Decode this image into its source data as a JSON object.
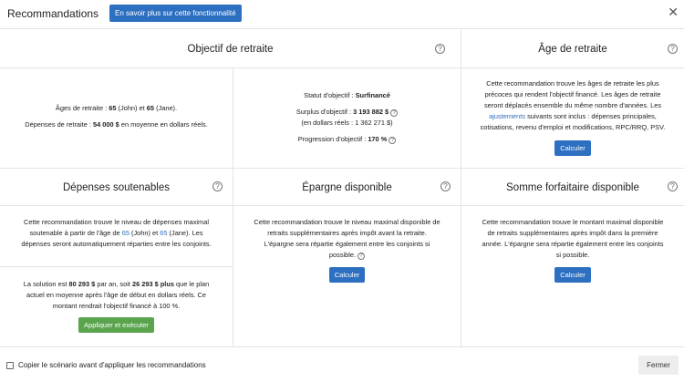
{
  "header": {
    "title": "Recommandations",
    "info_button": "En savoir plus sur cette fonctionnalité",
    "close_symbol": "✕"
  },
  "objectif": {
    "title": "Objectif de retraite",
    "ages_label": "Âges de retraite : ",
    "ages_john": "65",
    "ages_john_name": " (John) et ",
    "ages_jane": "65",
    "ages_jane_name": " (Jane).",
    "depenses_label": "Dépenses de retraite : ",
    "depenses_value": "54 000 $",
    "depenses_suffix": " en moyenne en dollars réels.",
    "statut_label": "Statut d'objectif : ",
    "statut_value": "Surfinancé",
    "surplus_label": "Surplus d'objectif : ",
    "surplus_value": "3 193 882 $",
    "surplus_real": "(en dollars réels : 1 362 271 $)",
    "progression_label": "Progression d'objectif : ",
    "progression_value": "170 %"
  },
  "age_retraite": {
    "title": "Âge de retraite",
    "text_1": "Cette recommandation trouve les âges de retraite les plus",
    "text_2": "précoces qui rendent l'objectif financé. Les âges de retraite",
    "text_3": "seront déplacés ensemble du même nombre d'années. Les",
    "text_link": "ajustements",
    "text_4": " suivants sont inclus : dépenses principales,",
    "text_5": "cotisations, revenu d'emploi et modifications, RPC/RRQ, PSV.",
    "button": "Calculer"
  },
  "depenses": {
    "title": "Dépenses soutenables",
    "text_1": "Cette recommandation trouve le niveau de dépenses maximal",
    "text_2a": "soutenable à partir de l'âge de ",
    "text_2_age1": "65",
    "text_2b": " (John) et ",
    "text_2_age2": "65",
    "text_2c": " (Jane). Les",
    "text_3": "dépenses seront automatiquement réparties entre les conjoints.",
    "sol_1a": "La solution est ",
    "sol_1_value": "80 293 $",
    "sol_1b": " par an, soit ",
    "sol_1_plus": "26 293 $ plus",
    "sol_1c": " que le plan",
    "sol_2": "actuel en moyenne après l'âge de début en dollars réels. Ce",
    "sol_3": "montant rendrait l'objectif financé à 100 %.",
    "button": "Appliquer et exécuter"
  },
  "epargne": {
    "title": "Épargne disponible",
    "text_1": "Cette recommandation trouve le niveau maximal disponible de",
    "text_2": "retraits supplémentaires après impôt avant la retraite.",
    "text_3": "L'épargne sera répartie également entre les conjoints si",
    "text_4": "possible.",
    "button": "Calculer"
  },
  "forfaitaire": {
    "title": "Somme forfaitaire disponible",
    "text_1": "Cette recommandation trouve le montant maximal disponible",
    "text_2": "de retraits supplémentaires après impôt dans la première",
    "text_3": "année. L'épargne sera répartie également entre les conjoints",
    "text_4": "si possible.",
    "button": "Calculer"
  },
  "footer": {
    "checkbox_label": "Copier le scénario avant d'appliquer les recommandations",
    "close_button": "Fermer"
  },
  "icons": {
    "help": "?"
  }
}
